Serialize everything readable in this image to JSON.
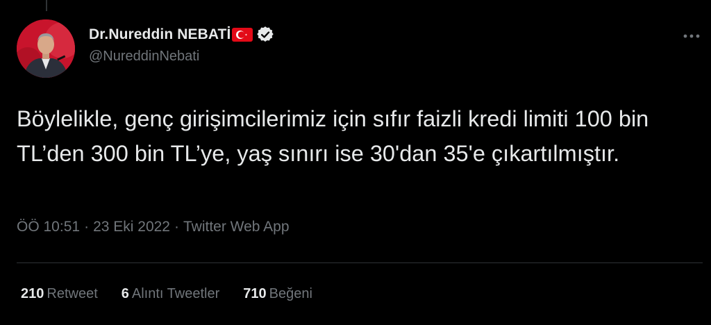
{
  "author": {
    "display_name": "Dr.Nureddin NEBATİ",
    "handle": "@NureddinNebati",
    "avatar_icon": "profile-photo",
    "flag_icon": "turkey-flag-icon",
    "verified_icon": "verified-badge-icon"
  },
  "more_icon": "more-options-icon",
  "tweet": {
    "text": "Böylelikle, genç girişimcilerimiz için sıfır faizli kredi limiti 100 bin TL’den 300 bin TL’ye, yaş sınırı ise 30'dan 35'e çıkartılmıştır."
  },
  "meta": {
    "time": "ÖÖ 10:51",
    "separator": "·",
    "date": "23 Eki 2022",
    "source": "Twitter Web App"
  },
  "stats": {
    "retweets": {
      "count": "210",
      "label": "Retweet"
    },
    "quotes": {
      "count": "6",
      "label": "Alıntı Tweetler"
    },
    "likes": {
      "count": "710",
      "label": "Beğeni"
    }
  },
  "colors": {
    "background": "#000000",
    "text_primary": "#e7e9ea",
    "text_secondary": "#71767b",
    "divider": "#2f3336",
    "flag_red": "#e30a17"
  }
}
